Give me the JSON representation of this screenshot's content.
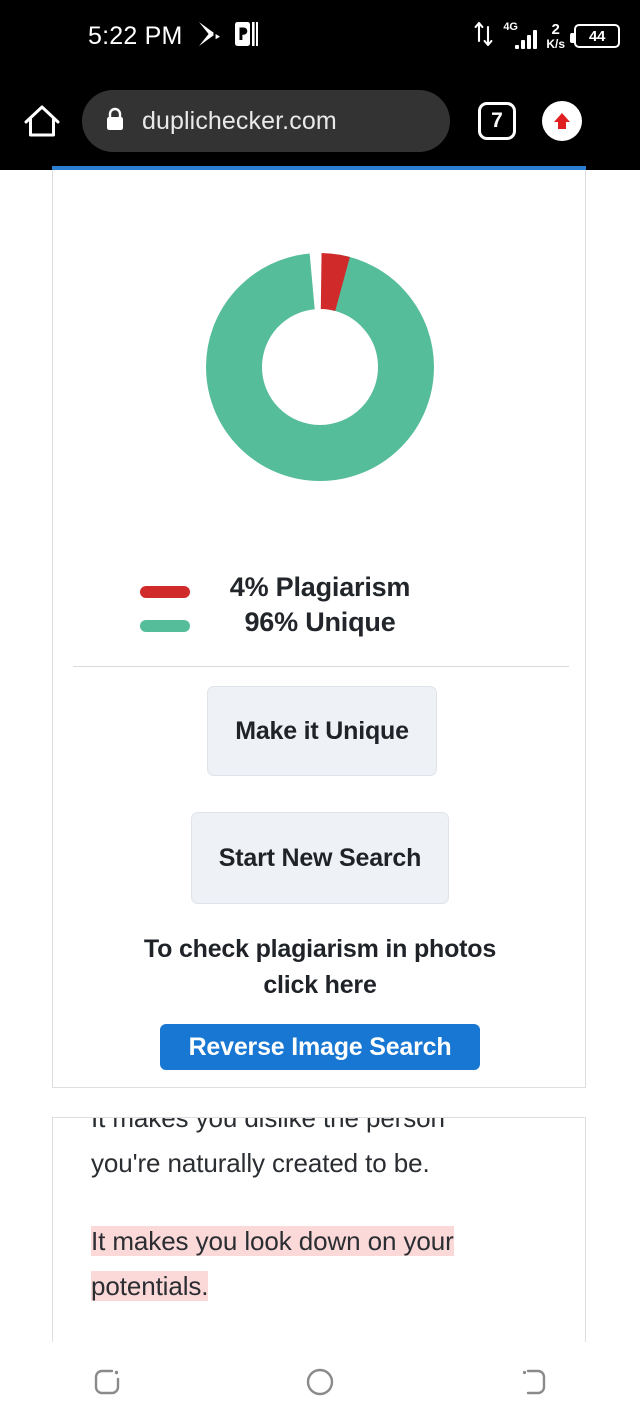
{
  "status_bar": {
    "time": "5:22 PM",
    "icons": [
      "play-store-icon",
      "powerpoint-icon"
    ],
    "data_transfer_icon": "up-down-arrows-icon",
    "network_type": "4G",
    "signal_icon": "signal-bars-icon",
    "data_rate_value": "2",
    "data_rate_unit": "K/s",
    "battery_level": "44"
  },
  "browser": {
    "home_icon": "home-icon",
    "lock_icon": "lock-icon",
    "url": "duplichecker.com",
    "tab_count": "7",
    "upload_icon": "upload-arrow-icon"
  },
  "result_card": {
    "accent_color": "#2b7cd3",
    "legend": [
      {
        "color": "#d02a2a",
        "label": "4% Plagiarism"
      },
      {
        "color": "#56bd9b",
        "label": "96% Unique"
      }
    ],
    "make_unique_label": "Make it Unique",
    "new_search_label": "Start New Search",
    "photo_note_line1": "To check plagiarism in photos",
    "photo_note_line2": "click here",
    "reverse_image_label": "Reverse Image Search",
    "reverse_image_color": "#1877d2"
  },
  "text_card": {
    "clipped_line": "It makes you dislike the person",
    "line2": "you're naturally created to be.",
    "highlighted": "It makes you look down on your potentials.",
    "highlight_color": "#fbd9d9"
  },
  "navbar": {
    "recents_icon": "recents-icon",
    "home_icon": "home-circle-icon",
    "back_icon": "back-icon"
  },
  "chart_data": {
    "type": "pie",
    "title": "",
    "categories": [
      "Plagiarism",
      "Unique"
    ],
    "values": [
      4,
      96
    ],
    "colors": [
      "#d02a2a",
      "#56bd9b"
    ],
    "labels": [
      "4% Plagiarism",
      "96% Unique"
    ],
    "donut": true,
    "inner_radius_ratio": 0.55,
    "start_angle": 0,
    "legend_position": "below"
  }
}
